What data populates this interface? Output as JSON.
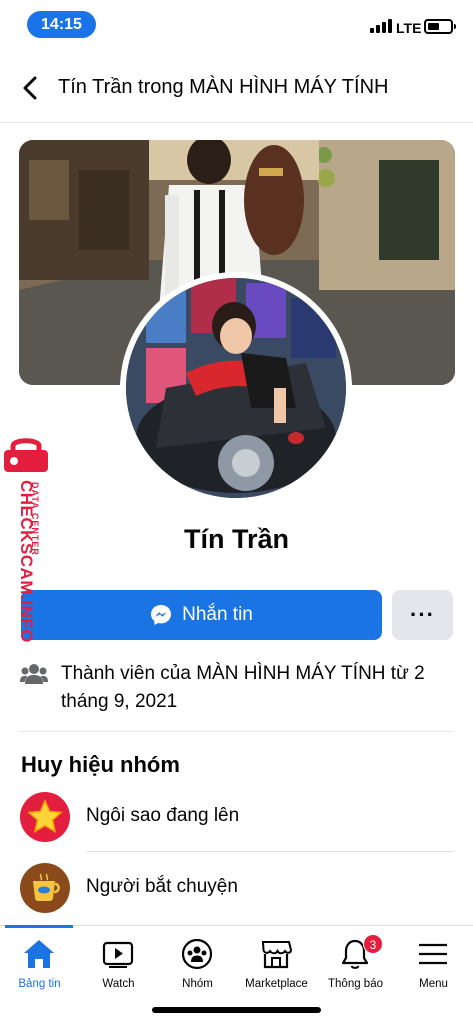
{
  "status_bar": {
    "time": "14:15",
    "network": "LTE",
    "pill_color": "#1a73e8"
  },
  "header": {
    "back_icon": "chevron-left-icon",
    "title": "Tín Trần trong MÀN HÌNH MÁY TÍNH"
  },
  "profile": {
    "name": "Tín Trần",
    "message_button": "Nhắn tin",
    "more_button": "···",
    "member_info": "Thành viên của MÀN HÌNH MÁY TÍNH từ 2 tháng 9, 2021"
  },
  "badges": {
    "title": "Huy hiệu nhóm",
    "items": [
      {
        "label": "Ngôi sao đang lên",
        "icon": "rising-star-icon",
        "color": "#e41e3f"
      },
      {
        "label": "Người bắt chuyện",
        "icon": "coffee-cup-icon",
        "color": "#8a4a1c"
      }
    ]
  },
  "watermark": {
    "brand": "CHECKSCAM.INFO",
    "tagline": "DATA CENTER",
    "color": "#e41e3f"
  },
  "tab_bar": {
    "tabs": [
      {
        "label": "Bảng tin",
        "icon": "home-icon",
        "active": true
      },
      {
        "label": "Watch",
        "icon": "video-icon",
        "active": false
      },
      {
        "label": "Nhóm",
        "icon": "groups-icon",
        "active": false
      },
      {
        "label": "Marketplace",
        "icon": "store-icon",
        "active": false
      },
      {
        "label": "Thông báo",
        "icon": "bell-icon",
        "active": false,
        "badge": "3"
      },
      {
        "label": "Menu",
        "icon": "hamburger-icon",
        "active": false
      }
    ],
    "accent": "#1b74e4"
  }
}
